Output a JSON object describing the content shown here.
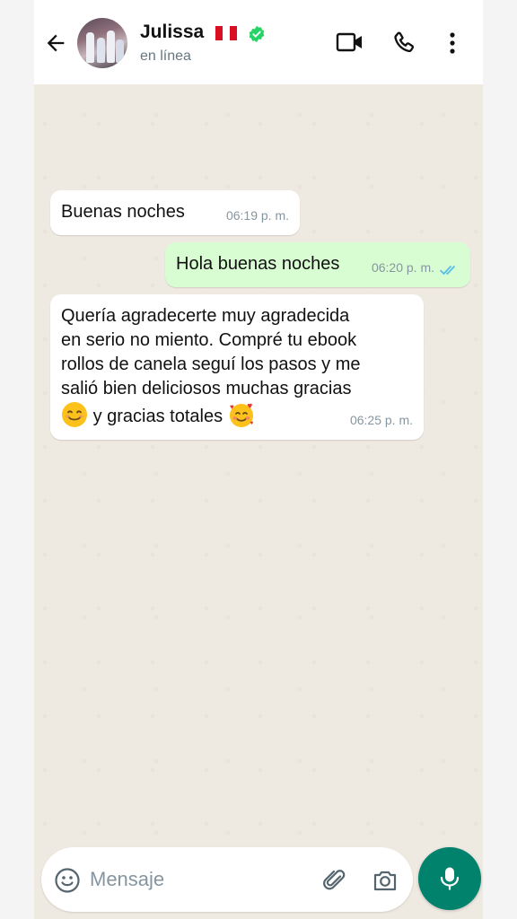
{
  "header": {
    "contact_name": "Julissa",
    "status": "en línea",
    "icons": [
      "back-arrow-icon",
      "video-call-icon",
      "phone-call-icon",
      "more-options-icon"
    ]
  },
  "messages": [
    {
      "direction": "incoming",
      "text": "Buenas noches",
      "time": "06:19 p. m."
    },
    {
      "direction": "outgoing",
      "text": "Hola buenas noches",
      "time": "06:20 p. m.",
      "read": true
    },
    {
      "direction": "incoming",
      "lines": [
        "Quería agradecerte muy agradecida",
        "en serio no miento. Compré tu ebook",
        "rollos de canela seguí los pasos y me",
        "salió bien deliciosos muchas gracias"
      ],
      "last_line_text": "y gracias totales",
      "time": "06:25 p. m."
    }
  ],
  "composer": {
    "placeholder": "Mensaje"
  },
  "colors": {
    "accent": "#00826d",
    "outgoing_bubble": "#d9fdd3",
    "verified": "#25d366",
    "read_ticks": "#53bdeb"
  }
}
